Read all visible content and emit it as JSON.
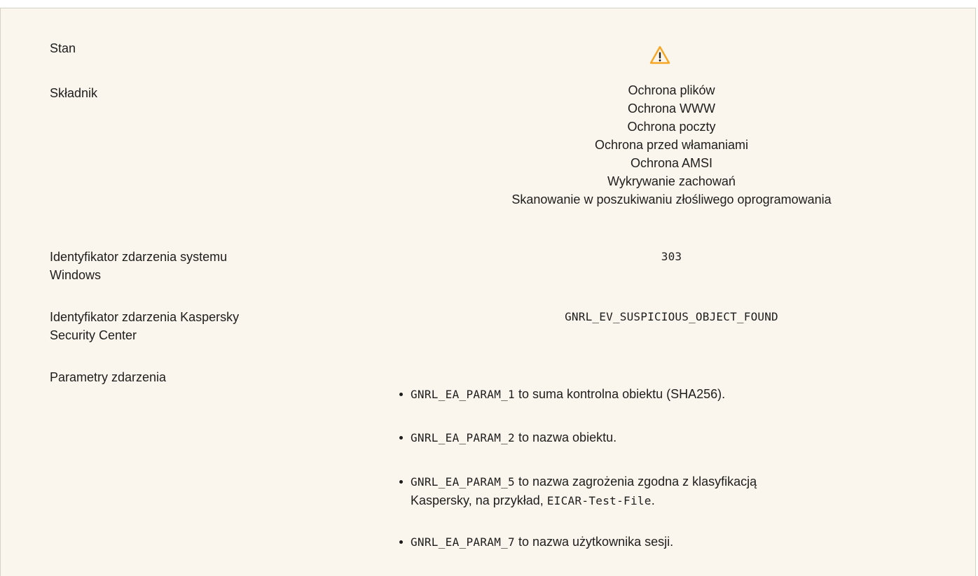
{
  "rows": {
    "status": {
      "label": "Stan",
      "icon": "warning-triangle-icon",
      "icon_color": "#f5a623"
    },
    "component": {
      "label": "Składnik",
      "items": [
        "Ochrona plików",
        "Ochrona WWW",
        "Ochrona poczty",
        "Ochrona przed włamaniami",
        "Ochrona AMSI",
        "Wykrywanie zachowań",
        "Skanowanie w poszukiwaniu złośliwego oprogramowania"
      ]
    },
    "windows_event_id": {
      "label_line1": "Identyfikator zdarzenia systemu",
      "label_line2": "Windows",
      "value": "303"
    },
    "ksc_event_id": {
      "label_line1": "Identyfikator zdarzenia Kaspersky",
      "label_line2": "Security Center",
      "value": "GNRL_EV_SUSPICIOUS_OBJECT_FOUND"
    },
    "event_params": {
      "label": "Parametry zdarzenia",
      "items": [
        {
          "code": "GNRL_EA_PARAM_1",
          "text": " to suma kontrolna obiektu (SHA256)."
        },
        {
          "code": "GNRL_EA_PARAM_2",
          "text": " to nazwa obiektu."
        },
        {
          "code": "GNRL_EA_PARAM_5",
          "text": " to nazwa zagrożenia zgodna z klasyfikacją",
          "text_line2": "Kaspersky, na przykład, ",
          "code2": "EICAR-Test-File",
          "text_end": "."
        },
        {
          "code": "GNRL_EA_PARAM_7",
          "text": " to nazwa użytkownika sesji."
        }
      ]
    }
  },
  "colors": {
    "panel_background": "#faf6ee",
    "border": "#d7d2c6",
    "text": "#1d1d1b",
    "warning": "#f5a623"
  }
}
